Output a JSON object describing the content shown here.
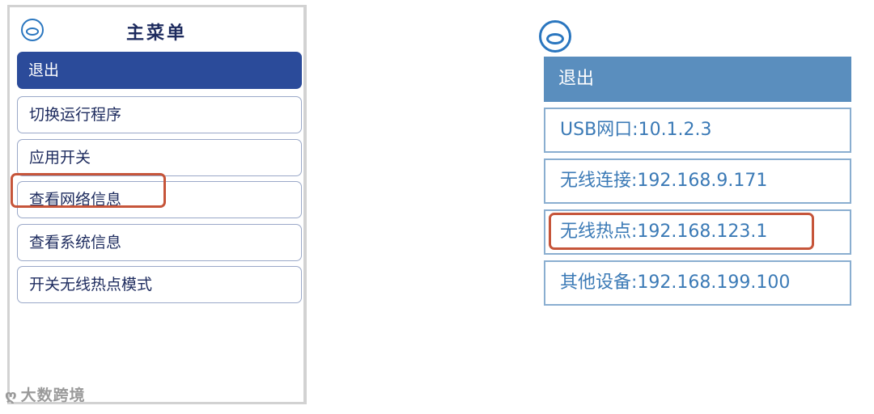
{
  "left_screen": {
    "title": "主菜单",
    "items": [
      {
        "label": "退出"
      },
      {
        "label": "切换运行程序"
      },
      {
        "label": "应用开关"
      },
      {
        "label": "查看网络信息"
      },
      {
        "label": "查看系统信息"
      },
      {
        "label": "开关无线热点模式"
      }
    ],
    "highlighted_item": "查看网络信息",
    "watermark": "大数跨境"
  },
  "right_screen": {
    "items": [
      {
        "label": "退出"
      },
      {
        "label": "USB网口:10.1.2.3"
      },
      {
        "label": "无线连接:192.168.9.171"
      },
      {
        "label": "无线热点:192.168.123.1"
      },
      {
        "label": "其他设备:192.168.199.100"
      }
    ],
    "highlighted_item": "无线热点:192.168.123.1"
  },
  "colors": {
    "active_left": "#2b4b9a",
    "active_right": "#5a8ebe",
    "highlight_outline": "#c6553a",
    "text_left": "#1d2b5e",
    "text_right": "#3b7ab6"
  },
  "icons": {
    "logo": "app-logo-icon",
    "watermark": "weibo-icon"
  }
}
